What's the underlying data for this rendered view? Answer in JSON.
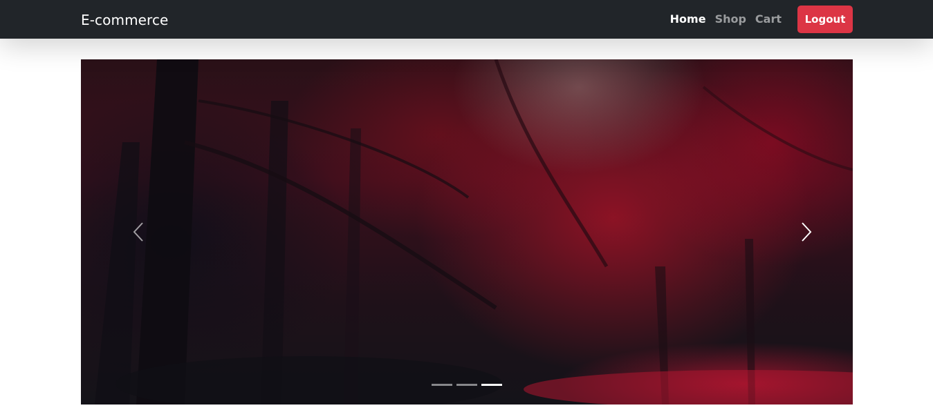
{
  "navbar": {
    "brand": "E-commerce",
    "links": [
      "Home",
      "Shop",
      "Cart"
    ],
    "active_link": "Home",
    "logout_label": "Logout",
    "colors": {
      "background": "#212529",
      "logout": "#dc3545"
    }
  },
  "carousel": {
    "image": "red-autumn-forest",
    "controls": [
      "chevron-left-icon",
      "chevron-right-icon"
    ],
    "slide_count": 3,
    "active_slide": 3
  }
}
